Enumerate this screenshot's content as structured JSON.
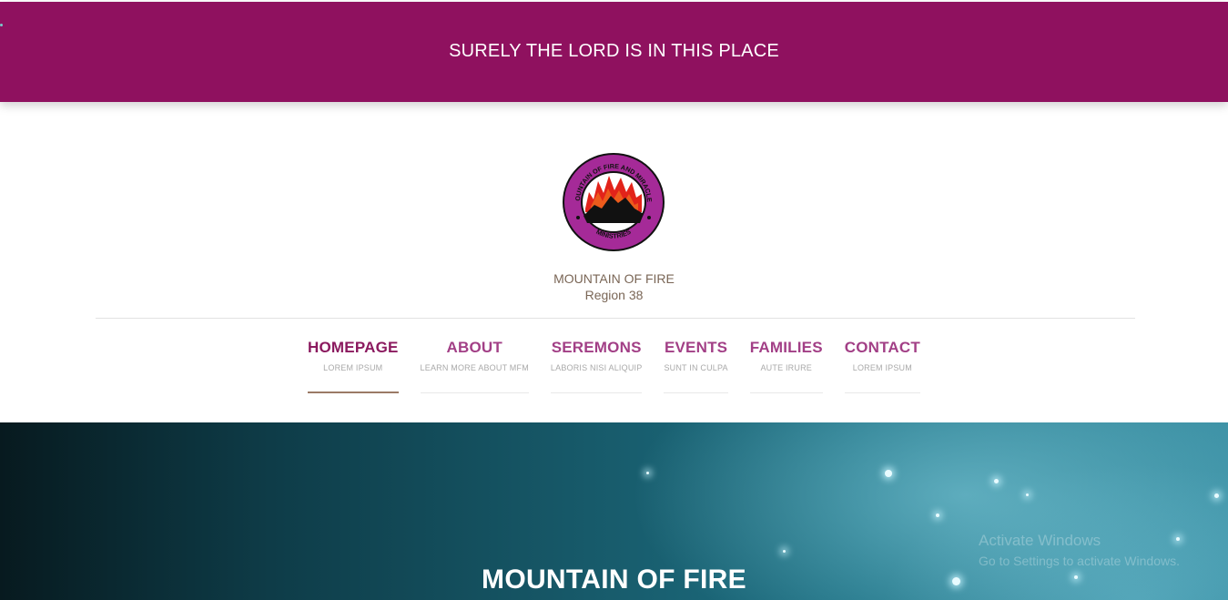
{
  "banner": {
    "text": "SURELY THE LORD IS IN THIS PLACE"
  },
  "brand": {
    "name": "MOUNTAIN OF FIRE",
    "region": "Region 38",
    "logo_text_top": "MOUNTAIN OF FIRE AND MIRACLES",
    "logo_text_bottom": "MINISTRIES"
  },
  "nav": {
    "items": [
      {
        "title": "HOMEPAGE",
        "sub": "LOREM IPSUM",
        "active": true
      },
      {
        "title": "ABOUT",
        "sub": "LEARN MORE ABOUT MFM"
      },
      {
        "title": "SEREMONS",
        "sub": "LABORIS NISI ALIQUIP"
      },
      {
        "title": "EVENTS",
        "sub": "SUNT IN CULPA"
      },
      {
        "title": "FAMILIES",
        "sub": "AUTE IRURE"
      },
      {
        "title": "CONTACT",
        "sub": "LOREM IPSUM"
      }
    ]
  },
  "hero": {
    "title": "MOUNTAIN OF FIRE"
  },
  "watermark": {
    "line1": "Activate Windows",
    "line2": "Go to Settings to activate Windows."
  },
  "colors": {
    "brand": "#8f115f",
    "nav_title": "#a23f86",
    "nav_active": "#8b1a5f"
  }
}
